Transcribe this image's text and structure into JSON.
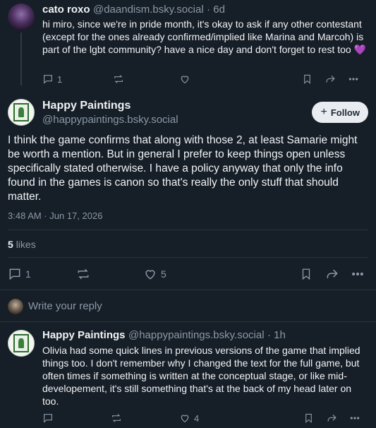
{
  "post1": {
    "name": "cato roxo",
    "handle": "@daandism.bsky.social",
    "time": "· 6d",
    "text": "hi miro, since we're in pride month, it's okay to ask if any other contestant (except for the ones already confirmed/implied like Marina and Marcoh) is part of the lgbt community? have a nice day and don't forget to rest too",
    "heart_emoji": "💜",
    "reply_count": "1"
  },
  "main": {
    "name": "Happy Paintings",
    "handle": "@happypaintings.bsky.social",
    "follow_label": "Follow",
    "text": "I think the game confirms that along with those 2, at least Samarie might be worth a mention. But in general I prefer to keep things open unless specifically stated otherwise. I have a policy anyway that only the info found in the games is canon so that's really the only stuff that should matter.",
    "timestamp": "3:48 AM · Jun 17, 2026",
    "likes_count": "5",
    "likes_label": "likes",
    "reply_count": "1",
    "like_count": "5"
  },
  "reply_box": {
    "placeholder": "Write your reply"
  },
  "post3": {
    "name": "Happy Paintings",
    "handle": "@happypaintings.bsky.social",
    "time": "· 1h",
    "text": "Olivia had some quick lines in previous versions of the game that implied things too. I don't remember why I changed the text for the full game, but often times if something is written at the conceptual stage, or like mid-developement, it's still something that's at the back of my head later on too.",
    "like_count": "4"
  },
  "colors": {
    "background": "#161e27",
    "muted": "#8b99a8",
    "accent_heart": "#a020f0"
  }
}
